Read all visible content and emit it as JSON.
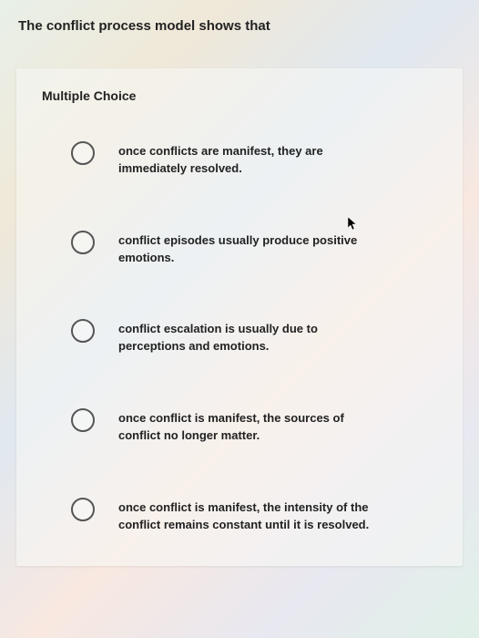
{
  "question": "The conflict process model shows that",
  "section_label": "Multiple Choice",
  "options": [
    {
      "text": "once conflicts are manifest, they are immediately resolved."
    },
    {
      "text": "conflict episodes usually produce positive emotions."
    },
    {
      "text": "conflict escalation is usually due to perceptions and emotions."
    },
    {
      "text": "once conflict is manifest, the sources of conflict no longer matter."
    },
    {
      "text": "once conflict is manifest, the intensity of the conflict remains constant until it is resolved."
    }
  ]
}
